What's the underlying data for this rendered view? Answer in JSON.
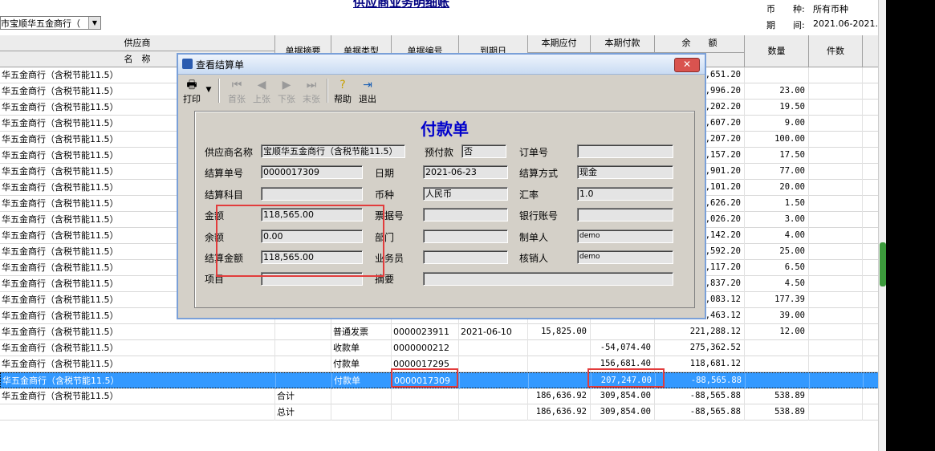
{
  "report": {
    "title": "供应商业务明细账",
    "supplier_combo": "市宝顺华五金商行（",
    "currency_label": "币　　种:",
    "currency_value": "所有币种",
    "period_label": "期　　间:",
    "period_value": "2021.06-2021.06"
  },
  "grid": {
    "headers": {
      "supplier": "供应商",
      "name": "名　称",
      "summary": "单据摘要",
      "doc_type": "单据类型",
      "doc_no": "单据编号",
      "due_date": "到期日",
      "payable": "本期应付",
      "paid": "本期付款",
      "balance": "余　　额",
      "qty": "数量",
      "pieces": "件数"
    },
    "rows": [
      {
        "name": "华五金商行（含税节能11.5）",
        "summary": "",
        "type": "",
        "no": "",
        "due": "",
        "payable": "",
        "paid": "",
        "balance": ",651.20",
        "qty": ""
      },
      {
        "name": "华五金商行（含税节能11.5）",
        "summary": "",
        "type": "",
        "no": "",
        "due": "",
        "payable": "",
        "paid": "",
        "balance": ",996.20",
        "qty": "23.00"
      },
      {
        "name": "华五金商行（含税节能11.5）",
        "summary": "",
        "type": "",
        "no": "",
        "due": "",
        "payable": "",
        "paid": "",
        "balance": ",202.20",
        "qty": "19.50"
      },
      {
        "name": "华五金商行（含税节能11.5）",
        "summary": "",
        "type": "",
        "no": "",
        "due": "",
        "payable": "",
        "paid": "",
        "balance": ",607.20",
        "qty": "9.00"
      },
      {
        "name": "华五金商行（含税节能11.5）",
        "summary": "",
        "type": "",
        "no": "",
        "due": "",
        "payable": "",
        "paid": "",
        "balance": ",207.20",
        "qty": "100.00"
      },
      {
        "name": "华五金商行（含税节能11.5）",
        "summary": "",
        "type": "",
        "no": "",
        "due": "",
        "payable": "",
        "paid": "",
        "balance": ",157.20",
        "qty": "17.50"
      },
      {
        "name": "华五金商行（含税节能11.5）",
        "summary": "",
        "type": "",
        "no": "",
        "due": "",
        "payable": "",
        "paid": "",
        "balance": ",901.20",
        "qty": "77.00"
      },
      {
        "name": "华五金商行（含税节能11.5）",
        "summary": "",
        "type": "",
        "no": "",
        "due": "",
        "payable": "",
        "paid": "",
        "balance": ",101.20",
        "qty": "20.00"
      },
      {
        "name": "华五金商行（含税节能11.5）",
        "summary": "",
        "type": "",
        "no": "",
        "due": "",
        "payable": "",
        "paid": "",
        "balance": ",626.20",
        "qty": "1.50"
      },
      {
        "name": "华五金商行（含税节能11.5）",
        "summary": "",
        "type": "",
        "no": "",
        "due": "",
        "payable": "",
        "paid": "",
        "balance": ",026.20",
        "qty": "3.00"
      },
      {
        "name": "华五金商行（含税节能11.5）",
        "summary": "",
        "type": "",
        "no": "",
        "due": "",
        "payable": "",
        "paid": "",
        "balance": ",142.20",
        "qty": "4.00"
      },
      {
        "name": "华五金商行（含税节能11.5）",
        "summary": "",
        "type": "",
        "no": "",
        "due": "",
        "payable": "",
        "paid": "",
        "balance": ",592.20",
        "qty": "25.00"
      },
      {
        "name": "华五金商行（含税节能11.5）",
        "summary": "",
        "type": "",
        "no": "",
        "due": "",
        "payable": "",
        "paid": "",
        "balance": ",117.20",
        "qty": "6.50"
      },
      {
        "name": "华五金商行（含税节能11.5）",
        "summary": "",
        "type": "",
        "no": "",
        "due": "",
        "payable": "",
        "paid": "",
        "balance": ",837.20",
        "qty": "4.50"
      },
      {
        "name": "华五金商行（含税节能11.5）",
        "summary": "",
        "type": "",
        "no": "",
        "due": "",
        "payable": "",
        "paid": "",
        "balance": ",083.12",
        "qty": "177.39"
      },
      {
        "name": "华五金商行（含税节能11.5）",
        "summary": "",
        "type": "",
        "no": "",
        "due": "",
        "payable": "",
        "paid": "",
        "balance": ",463.12",
        "qty": "39.00"
      },
      {
        "name": "华五金商行（含税节能11.5）",
        "summary": "",
        "type": "普通发票",
        "no": "0000023911",
        "due": "2021-06-10",
        "payable": "15,825.00",
        "paid": "",
        "balance": "221,288.12",
        "qty": "12.00"
      },
      {
        "name": "华五金商行（含税节能11.5）",
        "summary": "",
        "type": "收款单",
        "no": "0000000212",
        "due": "",
        "payable": "",
        "paid": "-54,074.40",
        "balance": "275,362.52",
        "qty": ""
      },
      {
        "name": "华五金商行（含税节能11.5）",
        "summary": "",
        "type": "付款单",
        "no": "0000017295",
        "due": "",
        "payable": "",
        "paid": "156,681.40",
        "balance": "118,681.12",
        "qty": ""
      },
      {
        "name": "华五金商行（含税节能11.5）",
        "summary": "",
        "type": "付款单",
        "no": "0000017309",
        "due": "",
        "payable": "",
        "paid": "207,247.00",
        "balance": "-88,565.88",
        "qty": "",
        "selected": true
      },
      {
        "name": "华五金商行（含税节能11.5）",
        "summary": "合计",
        "type": "",
        "no": "",
        "due": "",
        "payable": "186,636.92",
        "paid": "309,854.00",
        "balance": "-88,565.88",
        "qty": "538.89"
      },
      {
        "name": "",
        "summary": "总计",
        "type": "",
        "no": "",
        "due": "",
        "payable": "186,636.92",
        "paid": "309,854.00",
        "balance": "-88,565.88",
        "qty": "538.89"
      }
    ]
  },
  "dialog": {
    "title": "查看结算单",
    "close": "✕",
    "toolbar": {
      "print": "打印",
      "first": "首张",
      "prev": "上张",
      "next": "下张",
      "last": "末张",
      "help": "帮助",
      "exit": "退出"
    },
    "form_title": "付款单",
    "fields": {
      "supplier_name_label": "供应商名称",
      "supplier_name": "宝顺华五金商行（含税节能11.5）",
      "prepay_label": "预付款",
      "prepay": "否",
      "order_no_label": "订单号",
      "order_no": "",
      "settle_no_label": "结算单号",
      "settle_no": "0000017309",
      "date_label": "日期",
      "date": "2021-06-23",
      "settle_method_label": "结算方式",
      "settle_method": "现金",
      "settle_subject_label": "结算科目",
      "settle_subject": "",
      "currency_label": "币种",
      "currency": "人民币",
      "rate_label": "汇率",
      "rate": "1.0",
      "amount_label": "金额",
      "amount": "118,565.00",
      "bill_no_label": "票据号",
      "bill_no": "",
      "bank_acct_label": "银行账号",
      "bank_acct": "",
      "balance_label": "余额",
      "balance": "0.00",
      "dept_label": "部门",
      "dept": "",
      "maker_label": "制单人",
      "maker": "demo",
      "settle_amount_label": "结算金额",
      "settle_amount": "118,565.00",
      "salesman_label": "业务员",
      "salesman": "",
      "verifier_label": "核销人",
      "verifier": "demo",
      "project_label": "项目",
      "project": "",
      "memo_label": "摘要",
      "memo": ""
    }
  },
  "colors": {
    "selection": "#3399ff",
    "highlight_box": "#e23c3c",
    "form_title": "#0000cc"
  }
}
